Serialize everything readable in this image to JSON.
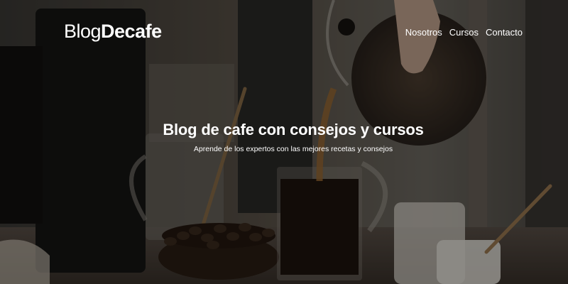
{
  "header": {
    "logo": {
      "light": "Blog",
      "bold": "Decafe"
    },
    "nav": [
      {
        "label": "Nosotros"
      },
      {
        "label": "Cursos"
      },
      {
        "label": "Contacto"
      }
    ]
  },
  "hero": {
    "title": "Blog de cafe con consejos y cursos",
    "subtitle": "Aprende de los expertos con las mejores recetas y consejos",
    "background": "coffee-scene-photo"
  },
  "colors": {
    "text": "#ffffff",
    "overlay": "#000000"
  }
}
